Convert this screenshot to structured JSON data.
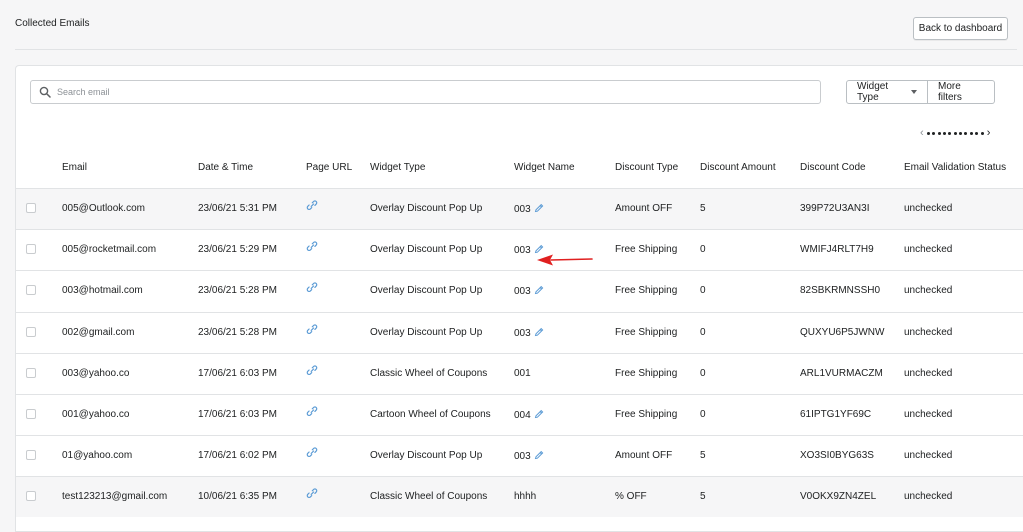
{
  "page": {
    "title": "Collected Emails",
    "back_label": "Back to dashboard"
  },
  "search": {
    "placeholder": "Search email",
    "value": ""
  },
  "filters": {
    "widget_type_label": "Widget Type",
    "more_filters_label": "More filters"
  },
  "pagination": {
    "prev": "‹",
    "next": "›"
  },
  "table": {
    "headers": {
      "email": "Email",
      "date_time": "Date & Time",
      "page_url": "Page URL",
      "widget_type": "Widget Type",
      "widget_name": "Widget Name",
      "discount_type": "Discount Type",
      "discount_amount": "Discount Amount",
      "discount_code": "Discount Code",
      "validation_status": "Email Validation Status"
    },
    "rows": [
      {
        "email": "005@Outlook.com",
        "date_time": "23/06/21 5:31 PM",
        "widget_type": "Overlay Discount Pop Up",
        "widget_name": "003",
        "editable": true,
        "discount_type": "Amount OFF",
        "discount_amount": "5",
        "discount_code": "399P72U3AN3I",
        "validation_status": "unchecked"
      },
      {
        "email": "005@rocketmail.com",
        "date_time": "23/06/21 5:29 PM",
        "widget_type": "Overlay Discount Pop Up",
        "widget_name": "003",
        "editable": true,
        "discount_type": "Free Shipping",
        "discount_amount": "0",
        "discount_code": "WMIFJ4RLT7H9",
        "validation_status": "unchecked"
      },
      {
        "email": "003@hotmail.com",
        "date_time": "23/06/21 5:28 PM",
        "widget_type": "Overlay Discount Pop Up",
        "widget_name": "003",
        "editable": true,
        "discount_type": "Free Shipping",
        "discount_amount": "0",
        "discount_code": "82SBKRMNSSH0",
        "validation_status": "unchecked"
      },
      {
        "email": "002@gmail.com",
        "date_time": "23/06/21 5:28 PM",
        "widget_type": "Overlay Discount Pop Up",
        "widget_name": "003",
        "editable": true,
        "discount_type": "Free Shipping",
        "discount_amount": "0",
        "discount_code": "QUXYU6P5JWNW",
        "validation_status": "unchecked"
      },
      {
        "email": "003@yahoo.co",
        "date_time": "17/06/21 6:03 PM",
        "widget_type": "Classic Wheel of Coupons",
        "widget_name": "001",
        "editable": false,
        "discount_type": "Free Shipping",
        "discount_amount": "0",
        "discount_code": "ARL1VURMACZM",
        "validation_status": "unchecked"
      },
      {
        "email": "001@yahoo.co",
        "date_time": "17/06/21 6:03 PM",
        "widget_type": "Cartoon Wheel of Coupons",
        "widget_name": "004",
        "editable": true,
        "discount_type": "Free Shipping",
        "discount_amount": "0",
        "discount_code": "61IPTG1YF69C",
        "validation_status": "unchecked"
      },
      {
        "email": "01@yahoo.com",
        "date_time": "17/06/21 6:02 PM",
        "widget_type": "Overlay Discount Pop Up",
        "widget_name": "003",
        "editable": true,
        "discount_type": "Amount OFF",
        "discount_amount": "5",
        "discount_code": "XO3SI0BYG63S",
        "validation_status": "unchecked"
      },
      {
        "email": "test123213@gmail.com",
        "date_time": "10/06/21 6:35 PM",
        "widget_type": "Classic Wheel of Coupons",
        "widget_name": "hhhh",
        "editable": false,
        "discount_type": "% OFF",
        "discount_amount": "5",
        "discount_code": "V0OKX9ZN4ZEL",
        "validation_status": "unchecked"
      }
    ]
  },
  "colors": {
    "link_icon": "#5b9bd5",
    "annotation_arrow": "#e02020",
    "border": "#e1e3e5"
  },
  "icons": {
    "search": "search-icon",
    "link": "link-icon",
    "edit": "pencil-icon",
    "caret": "caret-down-icon"
  }
}
